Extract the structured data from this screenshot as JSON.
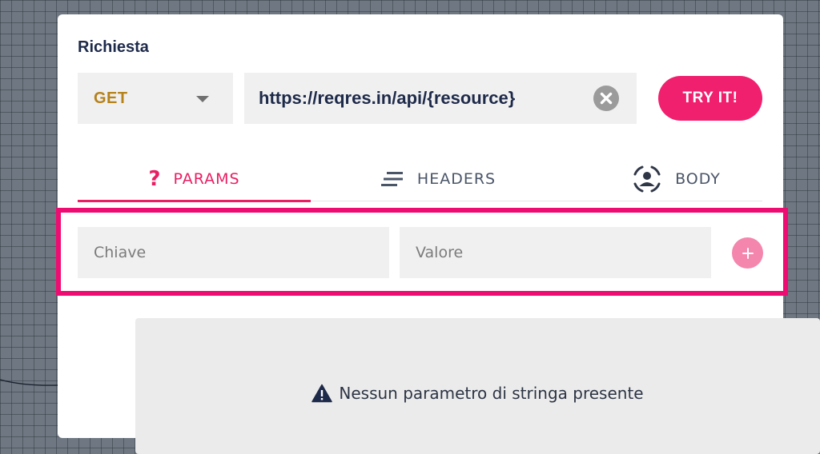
{
  "request": {
    "section_label": "Richiesta",
    "method": "GET",
    "url": "https://reqres.in/api/{resource}",
    "try_label": "TRY IT!"
  },
  "tabs": [
    {
      "label": "PARAMS",
      "icon": "question-icon",
      "active": true
    },
    {
      "label": "HEADERS",
      "icon": "lines-icon",
      "active": false
    },
    {
      "label": "BODY",
      "icon": "person-frame-icon",
      "active": false
    }
  ],
  "params": {
    "key_placeholder": "Chiave",
    "value_placeholder": "Valore",
    "add_icon": "plus-icon"
  },
  "empty_state": {
    "message": "Nessun parametro di stringa presente",
    "icon": "warning-icon"
  },
  "colors": {
    "accent": "#e91e63",
    "try_button": "#f1206e",
    "highlight": "#ee0c72",
    "method": "#b5821c",
    "text_dark": "#1e2a4a"
  }
}
